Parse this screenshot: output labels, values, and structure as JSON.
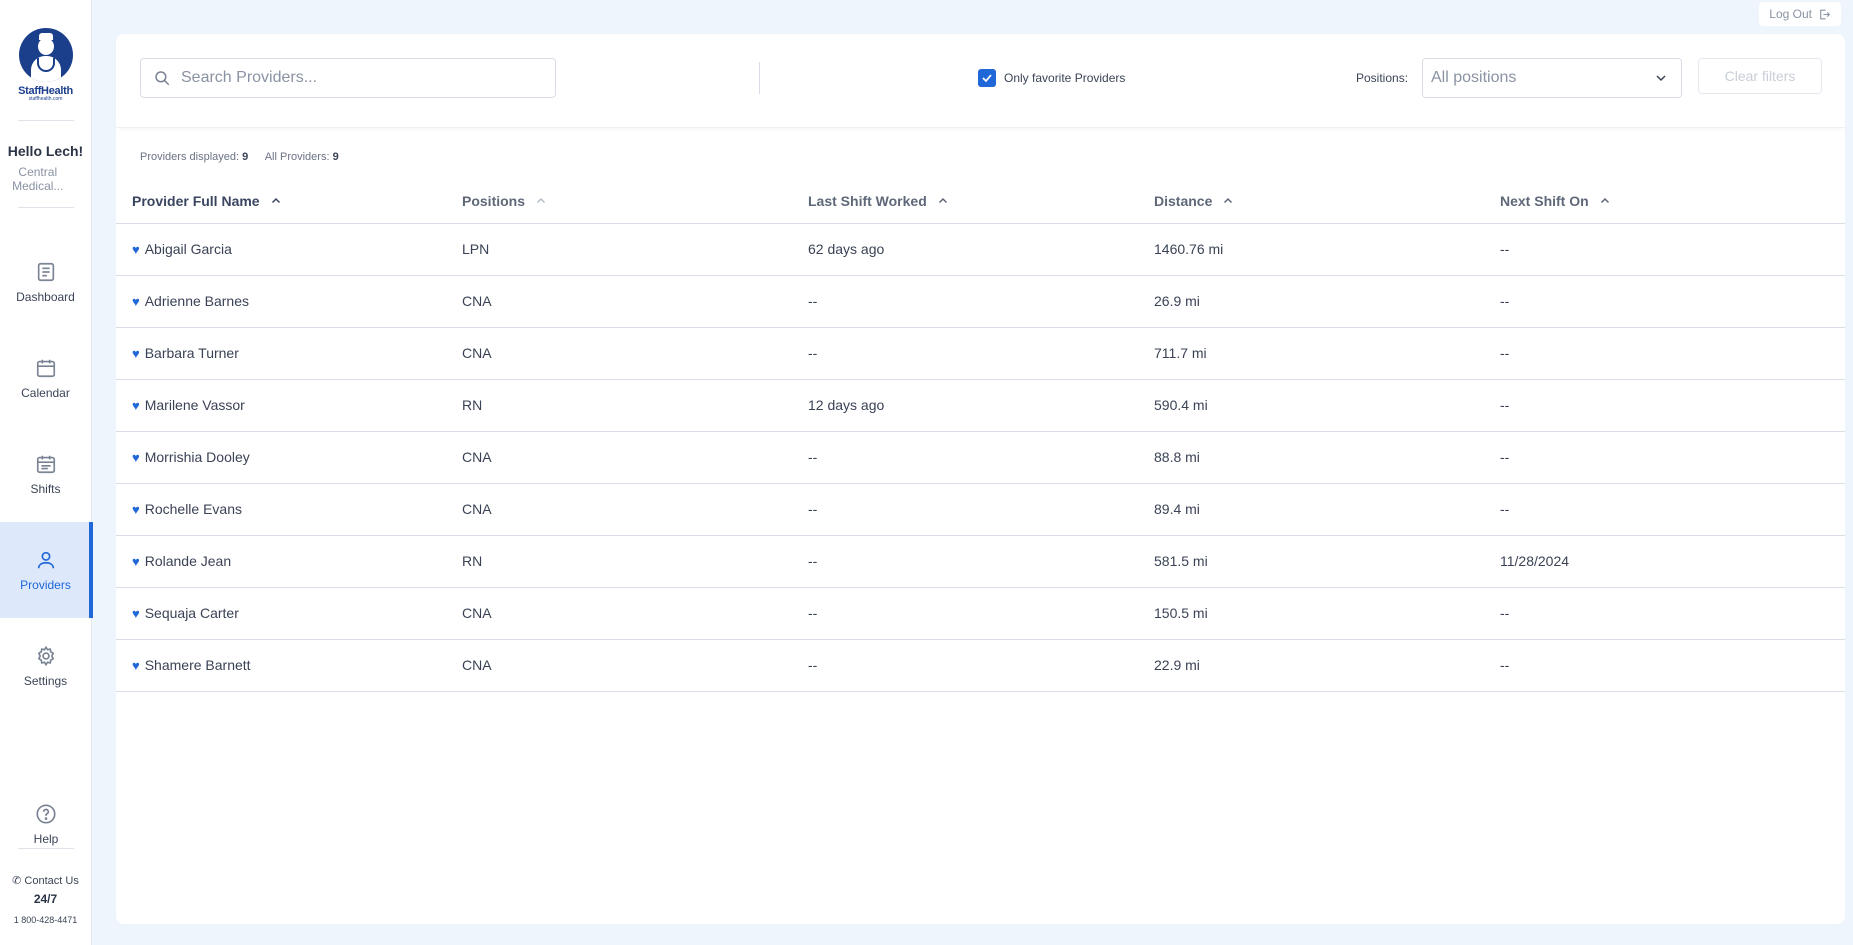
{
  "brand": {
    "name": "StaffHealth",
    "tagline": "staffhealth.com"
  },
  "user": {
    "greeting": "Hello Lech!",
    "org": "Central Medical..."
  },
  "nav": {
    "dashboard": "Dashboard",
    "calendar": "Calendar",
    "shifts": "Shifts",
    "providers": "Providers",
    "settings": "Settings",
    "help": "Help"
  },
  "contact": {
    "label": "Contact Us",
    "hours": "24/7",
    "phone": "1 800-428-4471"
  },
  "logout_label": "Log Out",
  "filters": {
    "search_placeholder": "Search Providers...",
    "favorite_label": "Only favorite Providers",
    "favorite_checked": true,
    "positions_label": "Positions:",
    "positions_value": "All positions",
    "clear_label": "Clear filters"
  },
  "counts": {
    "displayed_label": "Providers displayed:",
    "displayed_value": "9",
    "all_label": "All Providers:",
    "all_value": "9"
  },
  "table": {
    "columns": [
      "Provider Full Name",
      "Positions",
      "Last Shift Worked",
      "Distance",
      "Next Shift On"
    ],
    "rows": [
      [
        "Abigail Garcia",
        "LPN",
        "62 days ago",
        "1460.76 mi",
        "--"
      ],
      [
        "Adrienne Barnes",
        "CNA",
        "--",
        "26.9 mi",
        "--"
      ],
      [
        "Barbara Turner",
        "CNA",
        "--",
        "711.7 mi",
        "--"
      ],
      [
        "Marilene Vassor",
        "RN",
        "12 days ago",
        "590.4 mi",
        "--"
      ],
      [
        "Morrishia Dooley",
        "CNA",
        "--",
        "88.8 mi",
        "--"
      ],
      [
        "Rochelle Evans",
        "CNA",
        "--",
        "89.4 mi",
        "--"
      ],
      [
        "Rolande Jean",
        "RN",
        "--",
        "581.5 mi",
        "11/28/2024"
      ],
      [
        "Sequaja Carter",
        "CNA",
        "--",
        "150.5 mi",
        "--"
      ],
      [
        "Shamere Barnett",
        "CNA",
        "--",
        "22.9 mi",
        "--"
      ]
    ]
  },
  "colors": {
    "accent": "#2067d8",
    "brand": "#1c3f8c",
    "background": "#eef5fd"
  }
}
